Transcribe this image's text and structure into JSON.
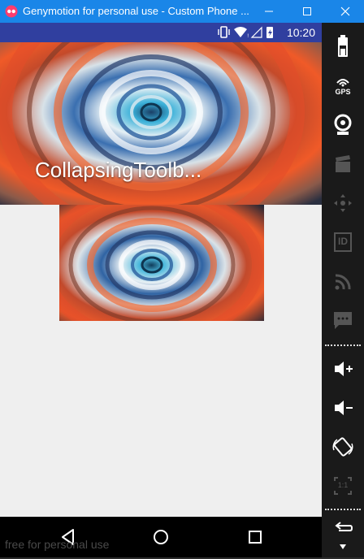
{
  "window": {
    "title": "Genymotion for personal use - Custom Phone ...",
    "controls": [
      "minimize",
      "maximize",
      "close"
    ]
  },
  "status_bar": {
    "time": "10:20",
    "icons": [
      "vibrate-icon",
      "wifi-icon",
      "signal-icon",
      "battery-icon"
    ]
  },
  "app": {
    "toolbar_title": "CollapsingToolb..."
  },
  "nav_bar": {
    "buttons": [
      "back",
      "home",
      "recents"
    ]
  },
  "watermark": "free for personal use",
  "side_panel": {
    "gps_label": "GPS",
    "id_label": "ID",
    "pixel_ratio_label": "1:1",
    "tools": [
      "battery",
      "gps",
      "webcam",
      "capture",
      "navigation",
      "id",
      "network",
      "sms",
      "volume-up",
      "volume-down",
      "rotate",
      "pixel-perfect",
      "back",
      "menu"
    ]
  },
  "colors": {
    "titlebar": "#1a86e8",
    "statusbar": "#303f9f",
    "screen_bg": "#efefef",
    "panel_bg": "#1a1a1a"
  }
}
